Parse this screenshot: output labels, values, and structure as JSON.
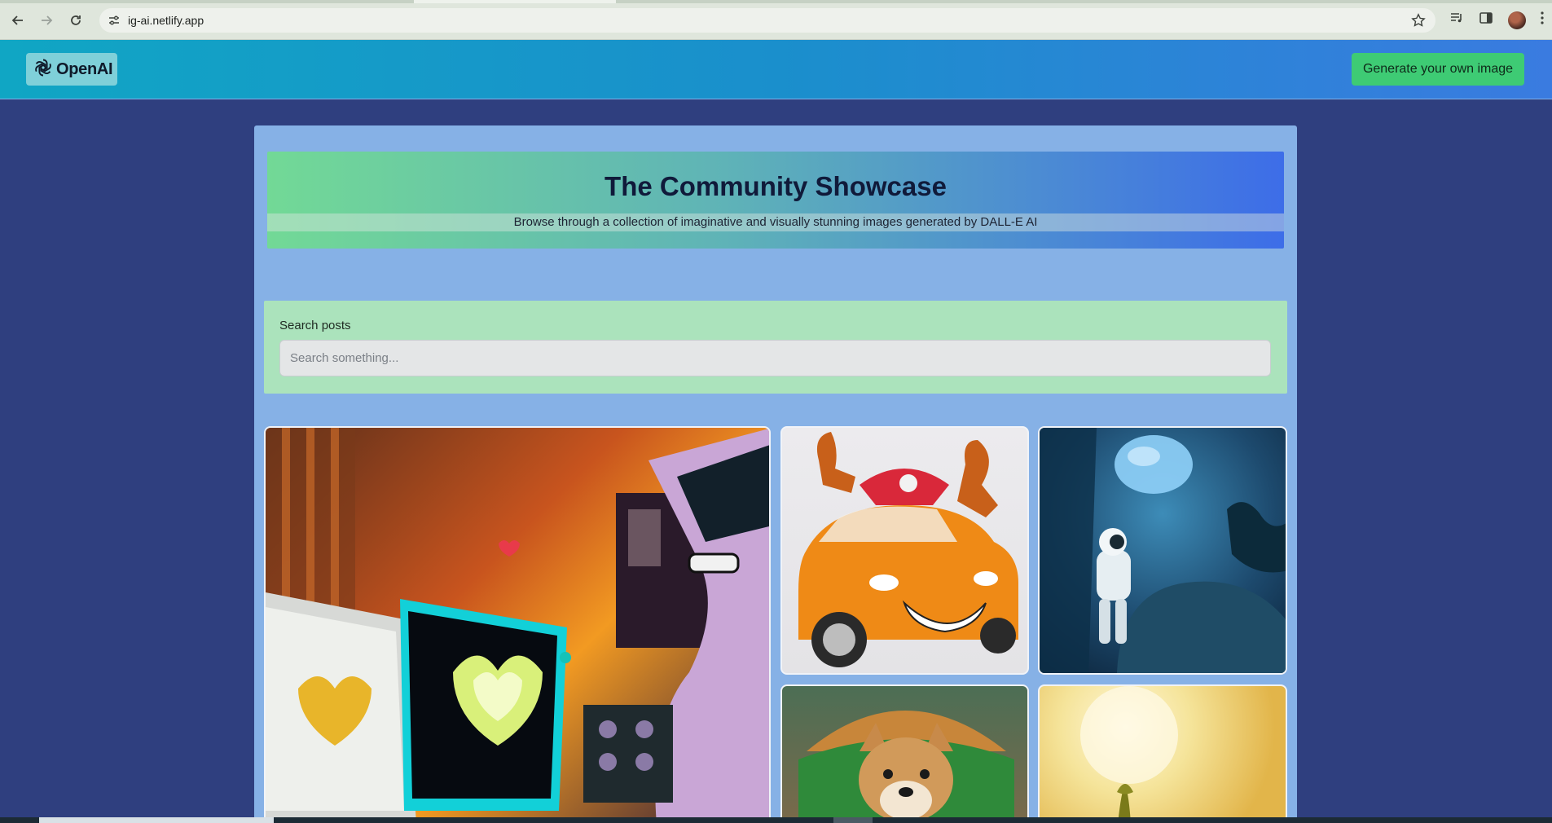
{
  "browser": {
    "url": "ig-ai.netlify.app"
  },
  "header": {
    "logo_text": "OpenAI",
    "generate_button_label": "Generate your own image"
  },
  "hero": {
    "title": "The Community Showcase",
    "subtitle": "Browse through a collection of imaginative and visually stunning images generated by DALL-E AI"
  },
  "search": {
    "label": "Search posts",
    "placeholder": "Search something..."
  },
  "gallery": {
    "items": [
      {
        "icon": "desk-hearts-illustration"
      },
      {
        "icon": "orange-car-illustration"
      },
      {
        "icon": "astronaut-jellyfish-illustration"
      },
      {
        "icon": "shiba-burger-illustration"
      },
      {
        "icon": "sunlit-meadow-illustration"
      }
    ]
  },
  "colors": {
    "page_bg": "#2f3f7f",
    "panel_bg": "#86b1e6",
    "search_box_bg": "#abe3bc",
    "generate_button_bg": "#3ecb74"
  }
}
